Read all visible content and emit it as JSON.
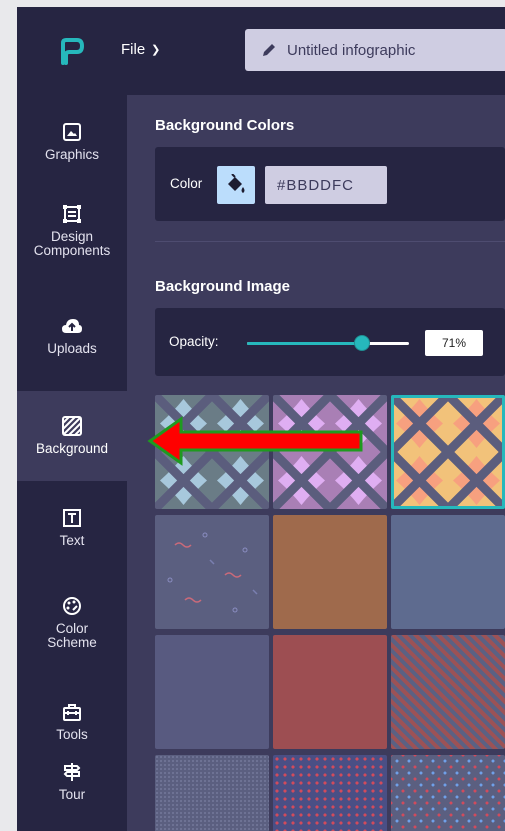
{
  "header": {
    "file_menu": "File",
    "title": "Untitled infographic"
  },
  "sidebar": {
    "items": [
      {
        "label": "Graphics",
        "icon": "image-icon",
        "active": false
      },
      {
        "label": "Design Components",
        "icon": "components-icon",
        "active": false
      },
      {
        "label": "Uploads",
        "icon": "cloud-upload-icon",
        "active": false
      },
      {
        "label": "Background",
        "icon": "background-hatch-icon",
        "active": true
      },
      {
        "label": "Text",
        "icon": "text-box-icon",
        "active": false
      },
      {
        "label": "Color Scheme",
        "icon": "palette-icon",
        "active": false
      },
      {
        "label": "Tools",
        "icon": "toolbox-icon",
        "active": false
      },
      {
        "label": "Tour",
        "icon": "signpost-icon",
        "active": false
      }
    ]
  },
  "panel": {
    "bg_colors_title": "Background Colors",
    "color_label": "Color",
    "color_value": "#BBDDFC",
    "bg_image_title": "Background Image",
    "opacity_label": "Opacity:",
    "opacity_value": "71%",
    "opacity_fraction": 0.71
  },
  "colors": {
    "accent": "#26b8bc",
    "sidebar_bg": "#262542",
    "panel_bg": "#3d3b5c",
    "arrow_fill": "#ff0000",
    "arrow_stroke": "#1f9a1f"
  },
  "tiles": [
    {
      "name": "wave-pattern-teal",
      "selected": false
    },
    {
      "name": "wave-pattern-purple",
      "selected": false
    },
    {
      "name": "wave-pattern-orange",
      "selected": true
    },
    {
      "name": "squiggle-pattern",
      "selected": false
    },
    {
      "name": "solid-brown",
      "selected": false
    },
    {
      "name": "solid-blue-grey",
      "selected": false
    },
    {
      "name": "solid-slate",
      "selected": false
    },
    {
      "name": "solid-red",
      "selected": false
    },
    {
      "name": "diagonal-stripes",
      "selected": false
    },
    {
      "name": "fine-dots",
      "selected": false
    },
    {
      "name": "red-dots",
      "selected": false
    },
    {
      "name": "mixed-dots",
      "selected": false
    }
  ]
}
